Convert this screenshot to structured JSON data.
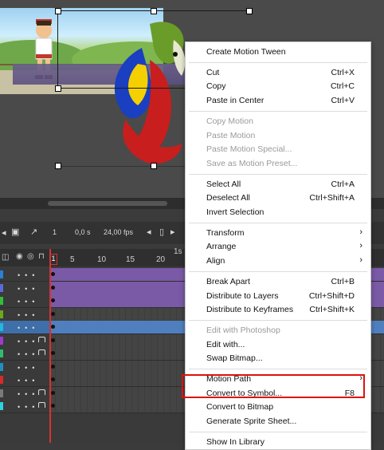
{
  "timeline": {
    "frame_start": "1",
    "time": "0,0 s",
    "fps": "24,00 fps",
    "ruler_ticks": [
      "1",
      "5",
      "10",
      "15",
      "20"
    ],
    "ruler_extra": "1s"
  },
  "context_menu": {
    "groups": [
      [
        {
          "label": "Create Motion Tween",
          "shortcut": "",
          "submenu": false,
          "disabled": false
        }
      ],
      [
        {
          "label": "Cut",
          "shortcut": "Ctrl+X",
          "submenu": false,
          "disabled": false
        },
        {
          "label": "Copy",
          "shortcut": "Ctrl+C",
          "submenu": false,
          "disabled": false
        },
        {
          "label": "Paste in Center",
          "shortcut": "Ctrl+V",
          "submenu": false,
          "disabled": false
        }
      ],
      [
        {
          "label": "Copy Motion",
          "shortcut": "",
          "submenu": false,
          "disabled": true
        },
        {
          "label": "Paste Motion",
          "shortcut": "",
          "submenu": false,
          "disabled": true
        },
        {
          "label": "Paste Motion Special...",
          "shortcut": "",
          "submenu": false,
          "disabled": true
        },
        {
          "label": "Save as Motion Preset...",
          "shortcut": "",
          "submenu": false,
          "disabled": true
        }
      ],
      [
        {
          "label": "Select All",
          "shortcut": "Ctrl+A",
          "submenu": false,
          "disabled": false
        },
        {
          "label": "Deselect All",
          "shortcut": "Ctrl+Shift+A",
          "submenu": false,
          "disabled": false
        },
        {
          "label": "Invert Selection",
          "shortcut": "",
          "submenu": false,
          "disabled": false
        }
      ],
      [
        {
          "label": "Transform",
          "shortcut": "",
          "submenu": true,
          "disabled": false
        },
        {
          "label": "Arrange",
          "shortcut": "",
          "submenu": true,
          "disabled": false
        },
        {
          "label": "Align",
          "shortcut": "",
          "submenu": true,
          "disabled": false
        }
      ],
      [
        {
          "label": "Break Apart",
          "shortcut": "Ctrl+B",
          "submenu": false,
          "disabled": false
        },
        {
          "label": "Distribute to Layers",
          "shortcut": "Ctrl+Shift+D",
          "submenu": false,
          "disabled": false
        },
        {
          "label": "Distribute to Keyframes",
          "shortcut": "Ctrl+Shift+K",
          "submenu": false,
          "disabled": false
        }
      ],
      [
        {
          "label": "Edit with Photoshop",
          "shortcut": "",
          "submenu": false,
          "disabled": true
        },
        {
          "label": "Edit with...",
          "shortcut": "",
          "submenu": false,
          "disabled": false
        },
        {
          "label": "Swap Bitmap...",
          "shortcut": "",
          "submenu": false,
          "disabled": false
        }
      ],
      [
        {
          "label": "Motion Path",
          "shortcut": "",
          "submenu": true,
          "disabled": false
        },
        {
          "label": "Convert to Symbol...",
          "shortcut": "F8",
          "submenu": false,
          "disabled": false
        },
        {
          "label": "Convert to Bitmap",
          "shortcut": "",
          "submenu": false,
          "disabled": false
        },
        {
          "label": "Generate Sprite Sheet...",
          "shortcut": "",
          "submenu": false,
          "disabled": false
        }
      ],
      [
        {
          "label": "Show In Library",
          "shortcut": "",
          "submenu": false,
          "disabled": false
        }
      ]
    ],
    "highlighted": "Convert to Symbol..."
  },
  "layers": {
    "colors": [
      "#2a7fd6",
      "#5a6ad6",
      "#2fbf3a",
      "#6aa81c",
      "#1fb8e0",
      "#9b3ccf",
      "#2dbf6e",
      "#1f8fbf",
      "#d62a2a",
      "#7a7a7a",
      "#2fd0e0"
    ]
  },
  "colors": {
    "menu_bg": "#ffffff",
    "highlight_border": "#e01010",
    "playhead": "#d83131",
    "tween_span": "#7a5aa6",
    "selected_layer": "#3f6fa8"
  }
}
